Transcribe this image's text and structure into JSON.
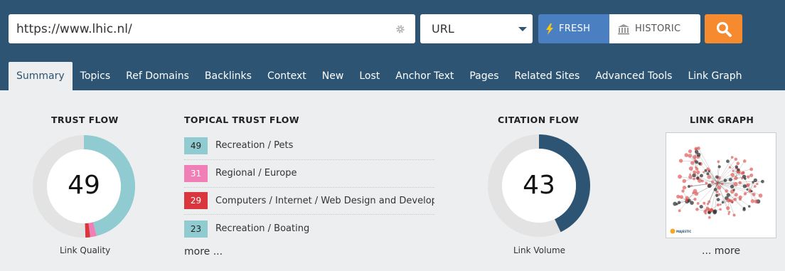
{
  "search": {
    "url_value": "https://www.lhic.nl/",
    "scope_value": "URL",
    "fresh_label": "FRESH",
    "historic_label": "HISTORIC"
  },
  "tabs": [
    {
      "label": "Summary",
      "active": true
    },
    {
      "label": "Topics"
    },
    {
      "label": "Ref Domains"
    },
    {
      "label": "Backlinks"
    },
    {
      "label": "Context"
    },
    {
      "label": "New"
    },
    {
      "label": "Lost"
    },
    {
      "label": "Anchor Text"
    },
    {
      "label": "Pages"
    },
    {
      "label": "Related Sites"
    },
    {
      "label": "Advanced Tools"
    },
    {
      "label": "Link Graph"
    }
  ],
  "trust_flow": {
    "title": "TRUST FLOW",
    "value": "49",
    "subtitle": "Link Quality",
    "ring_segments": [
      {
        "color": "#8fcbd0",
        "fraction": 0.46
      },
      {
        "color": "#ef7fb6",
        "fraction": 0.02
      },
      {
        "color": "#d9363e",
        "fraction": 0.015
      }
    ]
  },
  "topical_trust_flow": {
    "title": "TOPICAL TRUST FLOW",
    "items": [
      {
        "score": "49",
        "topic": "Recreation / Pets",
        "color": "#8fcbd0"
      },
      {
        "score": "31",
        "topic": "Regional / Europe",
        "color": "#ef7fb6"
      },
      {
        "score": "29",
        "topic": "Computers / Internet / Web Design and Development",
        "color": "#d9363e"
      },
      {
        "score": "23",
        "topic": "Recreation / Boating",
        "color": "#8fcbd0"
      }
    ],
    "more_label": "more ..."
  },
  "citation_flow": {
    "title": "CITATION FLOW",
    "value": "43",
    "subtitle": "Link Volume",
    "fraction": 0.43,
    "color": "#2d5472"
  },
  "link_graph": {
    "title": "LINK GRAPH",
    "logo_text": "MAJESTIC",
    "more_label": "... more"
  },
  "colors": {
    "header_bg": "#2d5472",
    "page_bg": "#eceeef",
    "fresh_button": "#4a7fc1",
    "search_button": "#f58a2f",
    "ring_track": "#e3e3e3"
  }
}
